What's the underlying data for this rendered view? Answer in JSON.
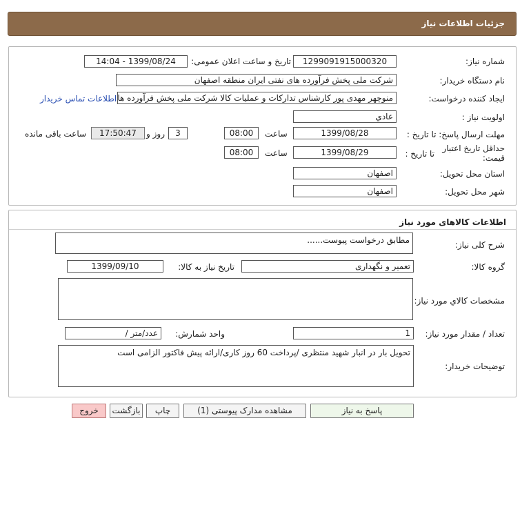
{
  "header": {
    "title": "جزئیات اطلاعات نیاز"
  },
  "need_info": {
    "need_number_label": "شماره نیاز:",
    "need_number": "1299091915000320",
    "announce_label": "تاریخ و ساعت اعلان عمومی:",
    "announce_value": "1399/08/24 - 14:04",
    "buyer_org_label": "نام دستگاه خریدار:",
    "buyer_org": "شرکت ملی پخش فرآورده های نفتی ایران منطقه اصفهان",
    "requester_label": "ایجاد کننده درخواست:",
    "requester": "منوچهر مهدی پور کارشناس تدارکات و عملیات کالا شرکت ملی پخش فرآورده های",
    "contact_link": "اطلاعات تماس خریدار",
    "priority_label": "اولویت نیاز :",
    "priority": "عادي",
    "reply_deadline_label": "مهلت ارسال پاسخ: تا تاریخ :",
    "reply_date": "1399/08/28",
    "time_label": "ساعت",
    "reply_time": "08:00",
    "days_value": "3",
    "days_label": "روز و",
    "remaining_time": "17:50:47",
    "remaining_label": "ساعت باقی مانده",
    "price_validity_label": "حداقل تاریخ اعتبار قیمت:",
    "to_date_label": "تا تاریخ :",
    "price_date": "1399/08/29",
    "price_time": "08:00",
    "province_label": "استان محل تحویل:",
    "province": "اصفهان",
    "city_label": "شهر محل تحویل:",
    "city": "اصفهان"
  },
  "goods": {
    "section_title": "اطلاعات کالاهای مورد نیاز",
    "summary_label": "شرح کلی نیاز:",
    "summary": "مطابق درخواست پیوست......",
    "group_label": "گروه کالا:",
    "group": "تعمیر و نگهداری",
    "need_date_label": "تاریخ نیاز به کالا:",
    "need_date": "1399/09/10",
    "specs_label": "مشخصات کالاي مورد نیاز:",
    "specs": "",
    "qty_label": "تعداد / مقدار مورد نیاز:",
    "qty": "1",
    "unit_label": "واحد شمارش:",
    "unit": "عدد/متر /",
    "buyer_notes_label": "توضیحات خریدار:",
    "buyer_notes": "تحویل بار در انبار شهید منتظری /پرداخت 60 روز کاری/ارائه پیش فاکتور الزامی است"
  },
  "buttons": {
    "reply": "پاسخ به نیاز",
    "attachments": "مشاهده مدارک پیوستی (1)",
    "print": "چاپ",
    "back": "بازگشت",
    "exit": "خروج"
  },
  "colors": {
    "header_bg": "#8c6a4a",
    "exit_bg": "#f9c9c9",
    "link": "#2a4fb3"
  }
}
